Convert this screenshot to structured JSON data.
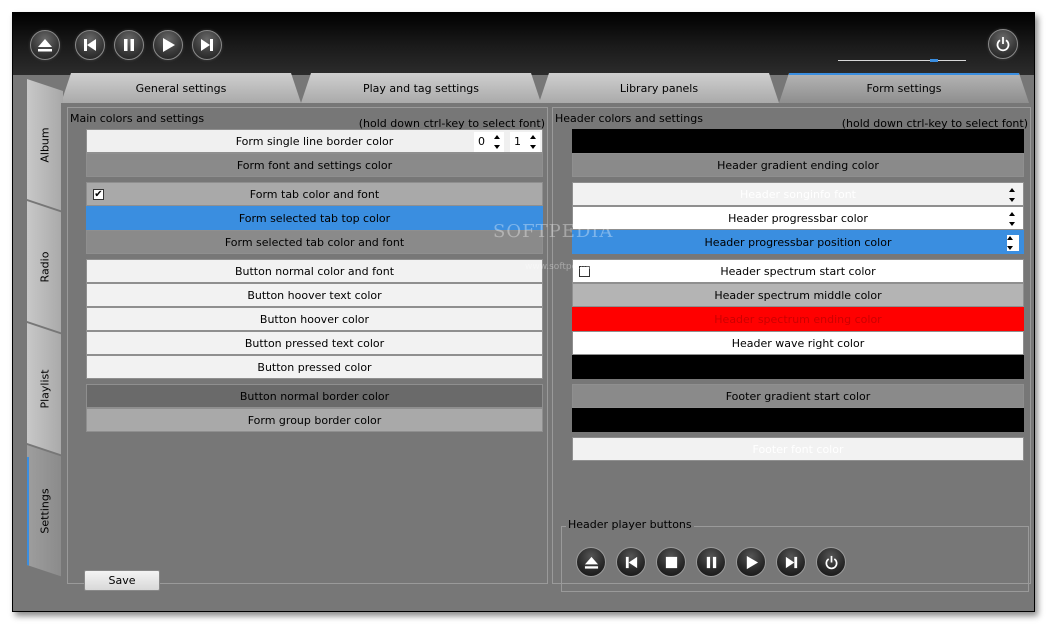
{
  "player_buttons": [
    {
      "name": "eject-button",
      "icon": "eject-icon"
    },
    {
      "name": "previous-button",
      "icon": "skip-previous-icon"
    },
    {
      "name": "pause-button",
      "icon": "pause-icon"
    },
    {
      "name": "play-button",
      "icon": "play-icon"
    },
    {
      "name": "next-button",
      "icon": "skip-next-icon"
    }
  ],
  "power_button": {
    "icon": "power-icon"
  },
  "tabs": [
    {
      "label": "General settings",
      "active": false
    },
    {
      "label": "Play and tag settings",
      "active": false
    },
    {
      "label": "Library panels",
      "active": false
    },
    {
      "label": "Form settings",
      "active": true
    }
  ],
  "side_tabs": [
    {
      "label": "Album",
      "active": false
    },
    {
      "label": "Radio",
      "active": false
    },
    {
      "label": "Playlist",
      "active": false
    },
    {
      "label": "Settings",
      "active": true
    }
  ],
  "left_panel": {
    "title": "Main colors and settings",
    "hint": "(hold down ctrl-key to select font)",
    "border_row": {
      "label": "Form single line border color",
      "spin1": "0",
      "spin2": "1"
    },
    "rows": [
      {
        "label": "Form font and settings color"
      },
      {
        "label": "Form tab color and font",
        "checked": true
      },
      {
        "label": "Form selected tab top color"
      },
      {
        "label": "Form selected tab color and font"
      },
      {
        "label": "Button normal color and font"
      },
      {
        "label": "Button hoover text color"
      },
      {
        "label": "Button hoover color"
      },
      {
        "label": "Button pressed text color"
      },
      {
        "label": "Button pressed color"
      },
      {
        "label": "Button normal border color"
      },
      {
        "label": "Form group border color"
      }
    ],
    "save_label": "Save"
  },
  "right_panel": {
    "title": "Header colors and settings",
    "hint": "(hold down ctrl-key to select font)",
    "rows": [
      {
        "label": ""
      },
      {
        "label": "Header gradient ending color"
      },
      {
        "label": "Header songinfo font"
      },
      {
        "label": "Header progressbar color"
      },
      {
        "label": "Header progressbar position color"
      },
      {
        "label": "Header spectrum start color",
        "checked": false
      },
      {
        "label": "Header spectrum middle color"
      },
      {
        "label": "Header spectrum ending color"
      },
      {
        "label": "Header wave right color"
      },
      {
        "label": ""
      },
      {
        "label": "Footer gradient start color"
      },
      {
        "label": ""
      },
      {
        "label": "Footer font color"
      }
    ],
    "group_title": "Header player buttons",
    "group_buttons": [
      {
        "name": "eject-button",
        "icon": "eject-icon"
      },
      {
        "name": "previous-button",
        "icon": "skip-previous-icon"
      },
      {
        "name": "stop-button",
        "icon": "stop-icon"
      },
      {
        "name": "pause-button",
        "icon": "pause-icon"
      },
      {
        "name": "play-button",
        "icon": "play-icon"
      },
      {
        "name": "next-button",
        "icon": "skip-next-icon"
      },
      {
        "name": "power-button",
        "icon": "power-icon"
      }
    ]
  },
  "watermark": {
    "text": "SOFTPEDIA",
    "url": "www.softpedia.com"
  },
  "colors": {
    "accent": "#3a8ee0",
    "red": "#ff0000",
    "panel_bg": "#777777"
  }
}
